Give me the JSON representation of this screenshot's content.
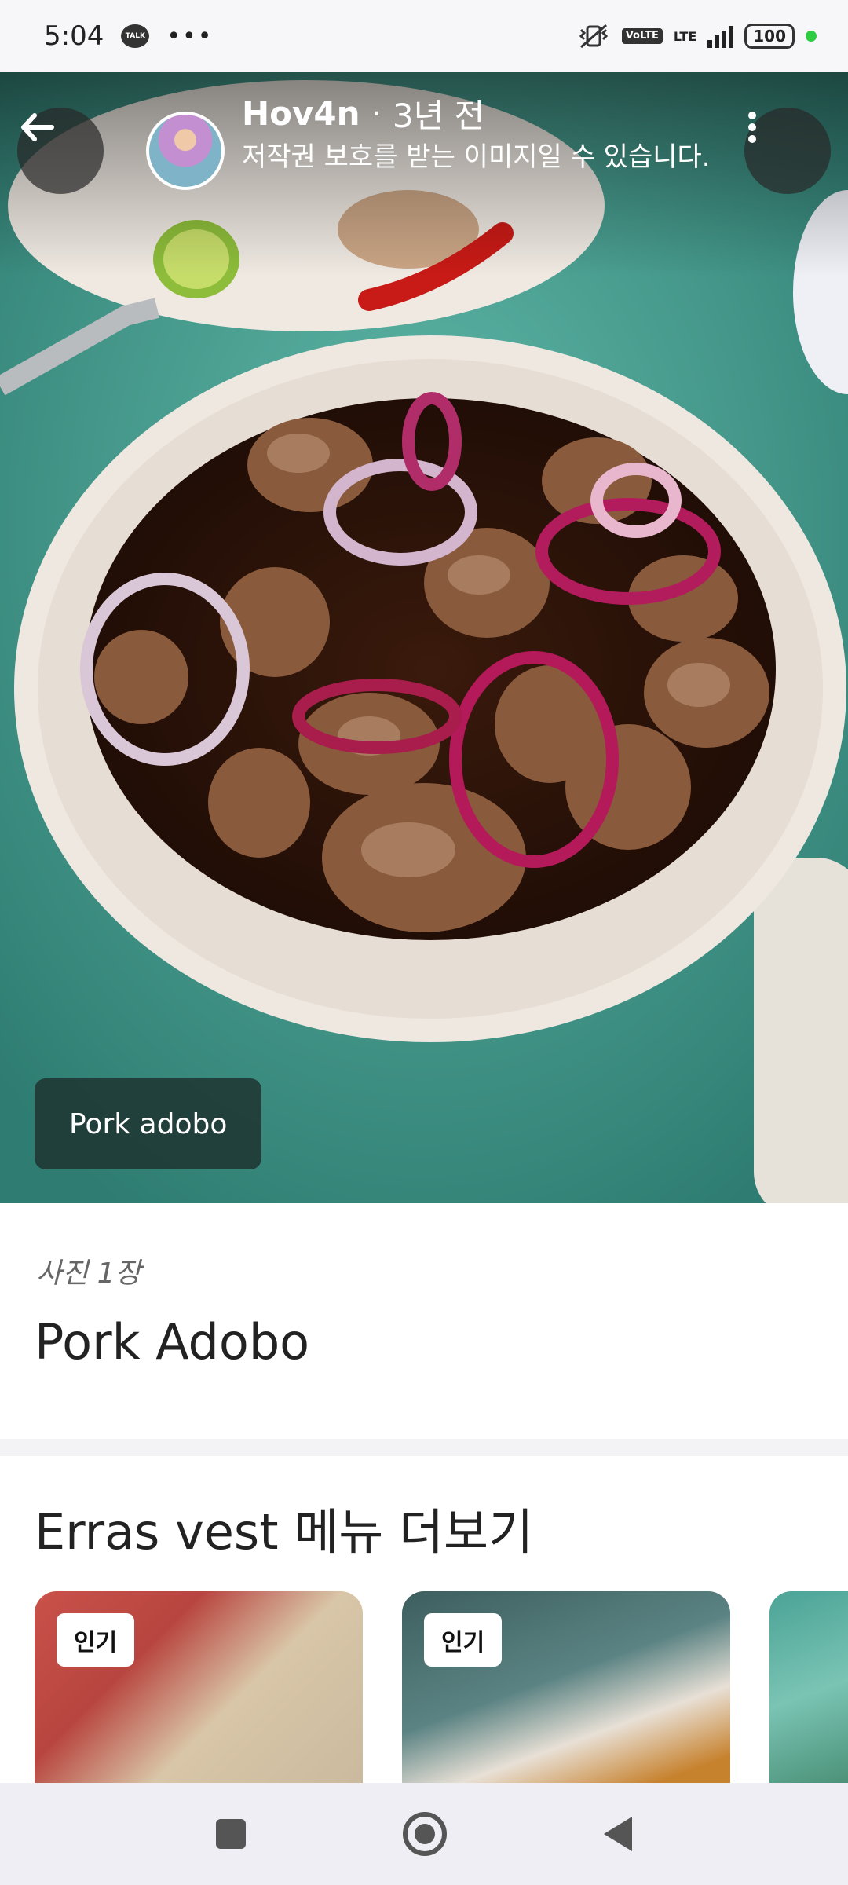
{
  "status_bar": {
    "time": "5:04",
    "talk_icon_label": "TALK",
    "more_dots": "•••",
    "volte_label": "VoLTE",
    "lte_label": "LTE",
    "battery_level": "100"
  },
  "photo": {
    "author_name": "Hov4n",
    "separator": "·",
    "posted_time": "3년 전",
    "copyright_notice": "저작권 보호를 받는 이미지일 수 있습니다.",
    "tag_label": "Pork adobo"
  },
  "info": {
    "photo_count": "사진 1장",
    "dish_name": "Pork Adobo"
  },
  "more_menu": {
    "title": "Erras vest 메뉴 더보기",
    "cards": [
      {
        "badge": "인기"
      },
      {
        "badge": "인기"
      },
      {
        "badge": ""
      }
    ]
  },
  "colors": {
    "accent_green": "#2ecc40",
    "overlay_tag": "#1e3430"
  }
}
